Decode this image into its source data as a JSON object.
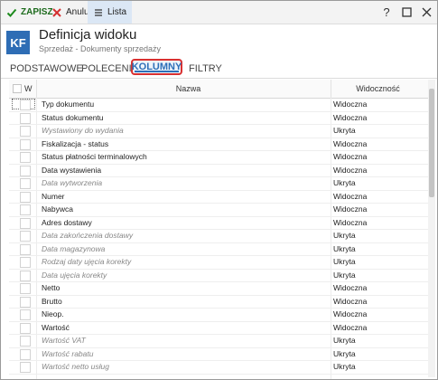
{
  "toolbar": {
    "save_label": "ZAPISZ",
    "cancel_label": "Anuluj",
    "list_label": "Lista",
    "help_symbol": "?",
    "colors": {
      "save": "#1d6b1d",
      "cancel": "#d33030"
    }
  },
  "header": {
    "badge": "KF",
    "title": "Definicja widoku",
    "subtitle": "Sprzedaż - Dokumenty sprzedaży"
  },
  "tabs": [
    {
      "label": "PODSTAWOWE"
    },
    {
      "label": "POLECENIA"
    },
    {
      "label": "KOLUMNY",
      "active": true
    },
    {
      "label": "FILTRY"
    }
  ],
  "table": {
    "headers": {
      "w": "W",
      "name": "Nazwa",
      "visibility": "Widoczność"
    },
    "rows": [
      {
        "name": "Typ dokumentu",
        "visibility": "Widoczna",
        "visible": true
      },
      {
        "name": "Status dokumentu",
        "visibility": "Widoczna",
        "visible": true
      },
      {
        "name": "Wystawiony do wydania",
        "visibility": "Ukryta",
        "visible": false
      },
      {
        "name": "Fiskalizacja - status",
        "visibility": "Widoczna",
        "visible": true
      },
      {
        "name": "Status płatności terminalowych",
        "visibility": "Widoczna",
        "visible": true
      },
      {
        "name": "Data wystawienia",
        "visibility": "Widoczna",
        "visible": true
      },
      {
        "name": "Data wytworzenia",
        "visibility": "Ukryta",
        "visible": false
      },
      {
        "name": "Numer",
        "visibility": "Widoczna",
        "visible": true
      },
      {
        "name": "Nabywca",
        "visibility": "Widoczna",
        "visible": true
      },
      {
        "name": "Adres dostawy",
        "visibility": "Widoczna",
        "visible": true
      },
      {
        "name": "Data zakończenia dostawy",
        "visibility": "Ukryta",
        "visible": false
      },
      {
        "name": "Data magazynowa",
        "visibility": "Ukryta",
        "visible": false
      },
      {
        "name": "Rodzaj daty ujęcia korekty",
        "visibility": "Ukryta",
        "visible": false
      },
      {
        "name": "Data ujęcia korekty",
        "visibility": "Ukryta",
        "visible": false
      },
      {
        "name": "Netto",
        "visibility": "Widoczna",
        "visible": true
      },
      {
        "name": "Brutto",
        "visibility": "Widoczna",
        "visible": true
      },
      {
        "name": "Nieop.",
        "visibility": "Widoczna",
        "visible": true
      },
      {
        "name": "Wartość",
        "visibility": "Widoczna",
        "visible": true
      },
      {
        "name": "Wartość VAT",
        "visibility": "Ukryta",
        "visible": false
      },
      {
        "name": "Wartość rabatu",
        "visibility": "Ukryta",
        "visible": false
      },
      {
        "name": "Wartość netto usług",
        "visibility": "Ukryta",
        "visible": false
      }
    ]
  }
}
